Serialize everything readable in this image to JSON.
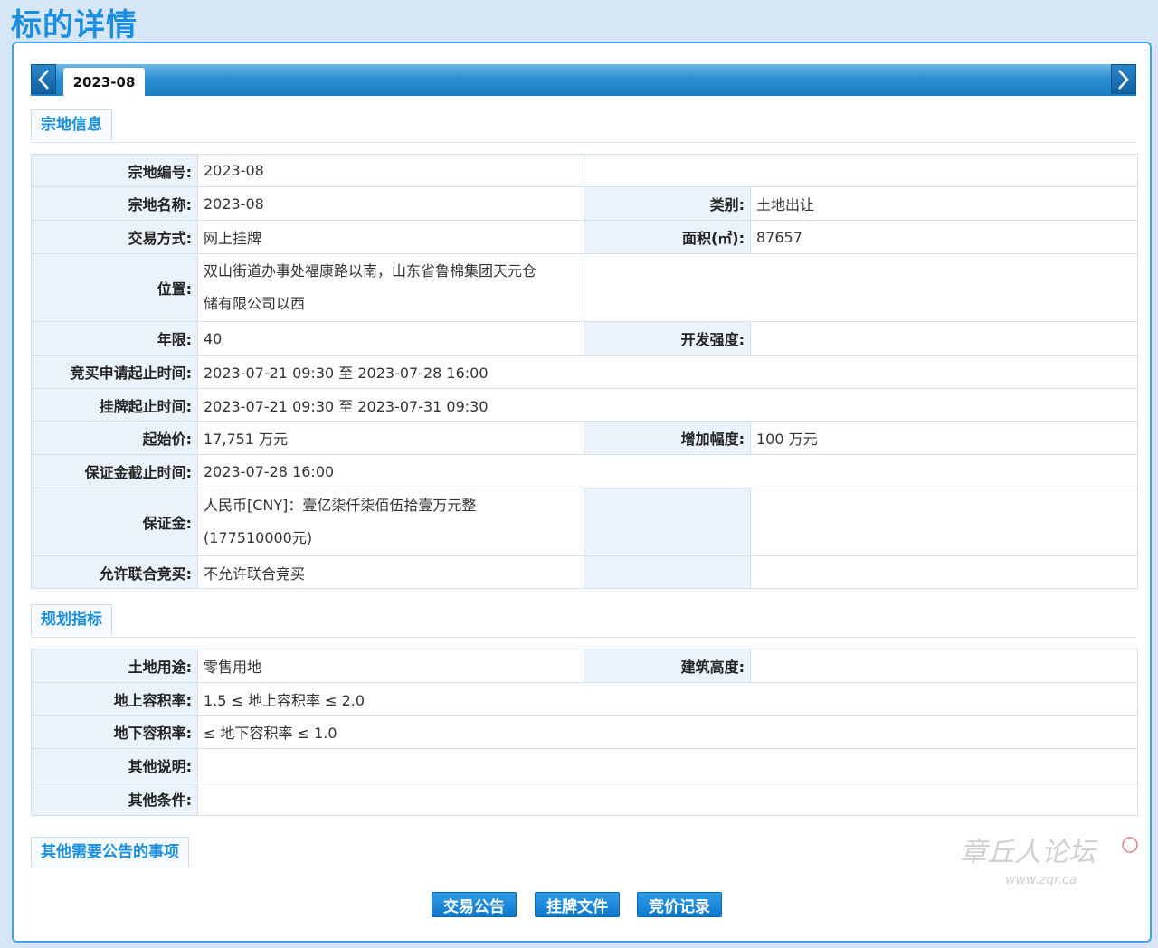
{
  "page": {
    "title": "标的详情"
  },
  "tabs": {
    "active": "2023-08"
  },
  "sections": {
    "parcel_info": "宗地信息",
    "planning": "规划指标",
    "other_notices": "其他需要公告的事项"
  },
  "parcel": {
    "code_label": "宗地编号:",
    "code": "2023-08",
    "name_label": "宗地名称:",
    "name": "2023-08",
    "category_label": "类别:",
    "category": "土地出让",
    "method_label": "交易方式:",
    "method": "网上挂牌",
    "area_label": "面积(㎡):",
    "area": "87657",
    "location_label": "位置:",
    "location_line1": "双山街道办事处福康路以南，山东省鲁棉集团天元仓",
    "location_line2": "储有限公司以西",
    "term_label": "年限:",
    "term": "40",
    "intensity_label": "开发强度:",
    "intensity": "",
    "apply_period_label": "竞买申请起止时间:",
    "apply_period": "2023-07-21 09:30 至 2023-07-28 16:00",
    "listing_period_label": "挂牌起止时间:",
    "listing_period": "2023-07-21 09:30 至 2023-07-31 09:30",
    "start_price_label": "起始价:",
    "start_price": "17,751 万元",
    "increment_label": "增加幅度:",
    "increment": "100 万元",
    "deposit_deadline_label": "保证金截止时间:",
    "deposit_deadline": "2023-07-28 16:00",
    "deposit_label": "保证金:",
    "deposit_line1": "人民币[CNY]：壹亿柒仟柒佰伍拾壹万元整",
    "deposit_line2": "(177510000元)",
    "joint_bid_label": "允许联合竞买:",
    "joint_bid": "不允许联合竞买"
  },
  "planning": {
    "land_use_label": "土地用途:",
    "land_use": "零售用地",
    "building_height_label": "建筑高度:",
    "building_height": "",
    "far_above_label": "地上容积率:",
    "far_above": "1.5 ≤ 地上容积率 ≤ 2.0",
    "far_below_label": "地下容积率:",
    "far_below": "≤ 地下容积率 ≤ 1.0",
    "other_notes_label": "其他说明:",
    "other_notes": "",
    "other_conditions_label": "其他条件:",
    "other_conditions": ""
  },
  "buttons": {
    "announcement": "交易公告",
    "listing_docs": "挂牌文件",
    "bid_records": "竞价记录"
  },
  "watermark": {
    "text": "章丘人论坛",
    "url": "www.zqr.ca"
  },
  "colors": {
    "accent": "#1a8fe0",
    "label_bg": "#eaf3fc",
    "page_bg": "#d6e6f6"
  }
}
